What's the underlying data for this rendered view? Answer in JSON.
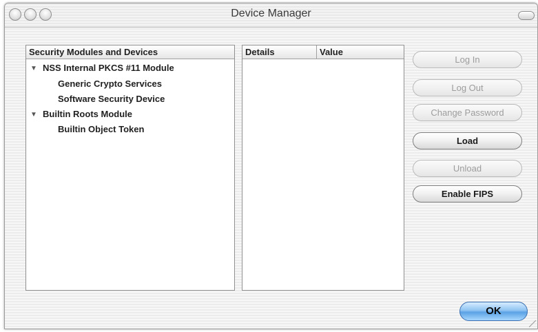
{
  "window": {
    "title": "Device Manager",
    "controls": [
      "close-button",
      "minimize-button",
      "zoom-button"
    ]
  },
  "modules_panel": {
    "header": "Security Modules and Devices",
    "items": [
      {
        "label": "NSS Internal PKCS #11 Module",
        "expanded": true,
        "level": 0
      },
      {
        "label": "Generic Crypto Services",
        "level": 1
      },
      {
        "label": "Software Security Device",
        "level": 1
      },
      {
        "label": "Builtin Roots Module",
        "expanded": true,
        "level": 0
      },
      {
        "label": "Builtin Object Token",
        "level": 1
      }
    ]
  },
  "details_panel": {
    "columns": [
      "Details",
      "Value"
    ]
  },
  "buttons": {
    "log_in": {
      "label": "Log In",
      "enabled": false
    },
    "log_out": {
      "label": "Log Out",
      "enabled": false
    },
    "change_password": {
      "label": "Change Password",
      "enabled": false
    },
    "load": {
      "label": "Load",
      "enabled": true
    },
    "unload": {
      "label": "Unload",
      "enabled": false
    },
    "enable_fips": {
      "label": "Enable FIPS",
      "enabled": true
    },
    "ok": {
      "label": "OK"
    }
  },
  "icons": {
    "expander": "▼",
    "expanded_arrow": "disclosure-triangle-down-icon"
  }
}
